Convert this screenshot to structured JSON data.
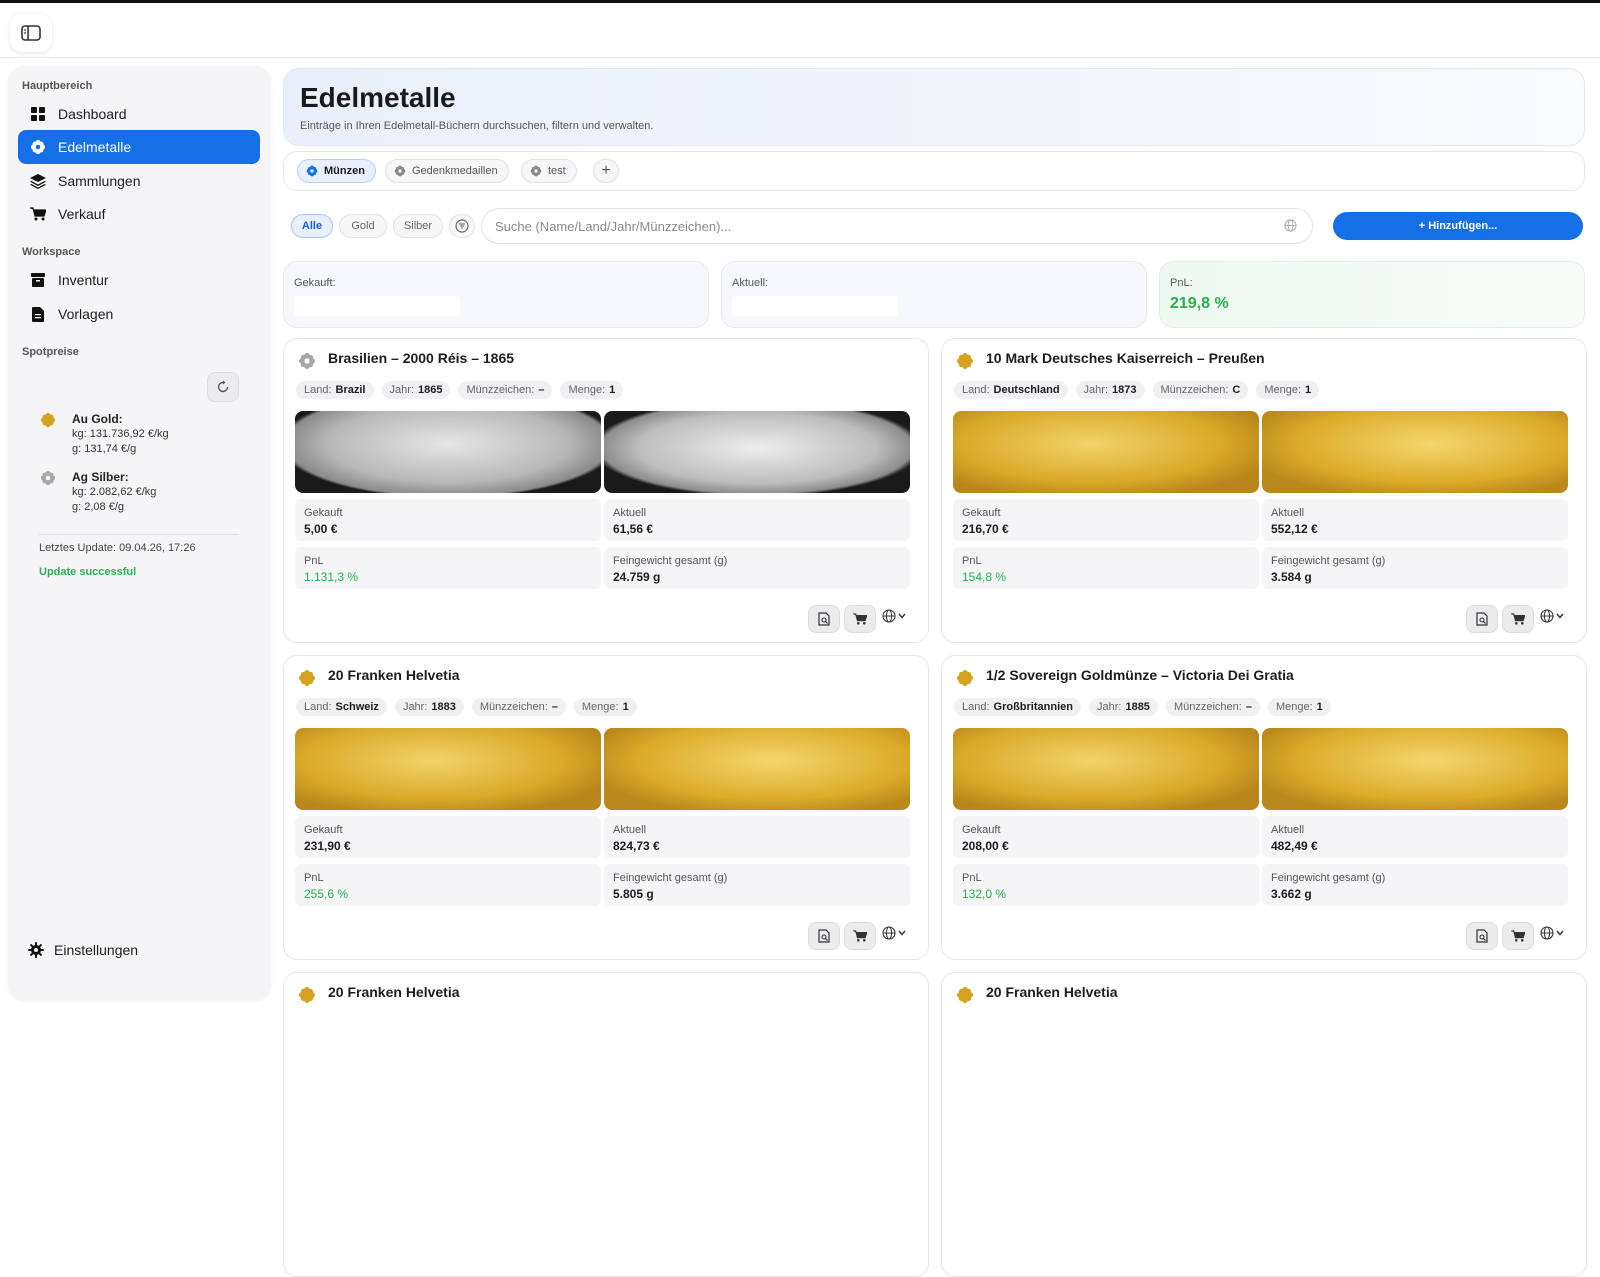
{
  "sidebar": {
    "sections": [
      "Hauptbereich",
      "Workspace",
      "Spotpreise"
    ],
    "main_items": [
      {
        "label": "Dashboard",
        "icon": "dashboard-icon"
      },
      {
        "label": "Edelmetalle",
        "icon": "flower-icon",
        "active": true
      },
      {
        "label": "Sammlungen",
        "icon": "layers-icon"
      },
      {
        "label": "Verkauf",
        "icon": "cart-icon"
      }
    ],
    "workspace_items": [
      {
        "label": "Inventur",
        "icon": "archive-icon"
      },
      {
        "label": "Vorlagen",
        "icon": "document-icon"
      }
    ],
    "spot": {
      "gold": {
        "name": "Au Gold:",
        "kg": "kg: 131.736,92 €/kg",
        "g": "g: 131,74 €/g"
      },
      "silver": {
        "name": "Ag Silber:",
        "kg": "kg: 2.082,62 €/kg",
        "g": "g: 2,08 €/g"
      },
      "last_update": "Letztes Update: 09.04.26, 17:26",
      "status": "Update successful"
    },
    "settings_label": "Einstellungen"
  },
  "header": {
    "title": "Edelmetalle",
    "subtitle": "Einträge in Ihren Edelmetall-Büchern durchsuchen, filtern und verwalten."
  },
  "tabs": [
    {
      "label": "Münzen",
      "active": true
    },
    {
      "label": "Gedenkmedaillen"
    },
    {
      "label": "test"
    }
  ],
  "filters": {
    "chips": [
      "Alle",
      "Gold",
      "Silber"
    ],
    "search_placeholder": "Suche (Name/Land/Jahr/Münzzeichen)...",
    "add_label": "+ Hinzufügen..."
  },
  "stats": {
    "bought_label": "Gekauft:",
    "current_label": "Aktuell:",
    "pnl_label": "PnL:",
    "pnl_value": "219,8 %"
  },
  "labels": {
    "land": "Land:",
    "jahr": "Jahr:",
    "mz": "Münzzeichen:",
    "menge": "Menge:",
    "gekauft": "Gekauft",
    "aktuell": "Aktuell",
    "pnl": "PnL",
    "fein": "Feingewicht gesamt (g)"
  },
  "colors": {
    "accent": "#1570e8",
    "positive": "#27b04a",
    "gold": "#d6a320",
    "silver": "#a7a7a7"
  },
  "cards": [
    {
      "title": "Brasilien – 2000 Réis – 1865",
      "metal": "silver",
      "land": "Brazil",
      "jahr": "1865",
      "mz": "–",
      "menge": "1",
      "gekauft": "5,00 €",
      "aktuell": "61,56 €",
      "pnl": "1.131,3 %",
      "fein": "24.759 g"
    },
    {
      "title": "10 Mark Deutsches Kaiserreich – Preußen",
      "metal": "gold",
      "land": "Deutschland",
      "jahr": "1873",
      "mz": "C",
      "menge": "1",
      "gekauft": "216,70 €",
      "aktuell": "552,12 €",
      "pnl": "154,8 %",
      "fein": "3.584 g"
    },
    {
      "title": "20 Franken Helvetia",
      "metal": "gold",
      "land": "Schweiz",
      "jahr": "1883",
      "mz": "–",
      "menge": "1",
      "gekauft": "231,90 €",
      "aktuell": "824,73 €",
      "pnl": "255,6 %",
      "fein": "5.805 g"
    },
    {
      "title": "1/2 Sovereign Goldmünze – Victoria Dei Gratia",
      "metal": "gold",
      "land": "Großbritannien",
      "jahr": "1885",
      "mz": "–",
      "menge": "1",
      "gekauft": "208,00 €",
      "aktuell": "482,49 €",
      "pnl": "132,0 %",
      "fein": "3.662 g"
    },
    {
      "title": "20 Franken Helvetia",
      "metal": "gold"
    },
    {
      "title": "20 Franken Helvetia",
      "metal": "gold"
    }
  ]
}
